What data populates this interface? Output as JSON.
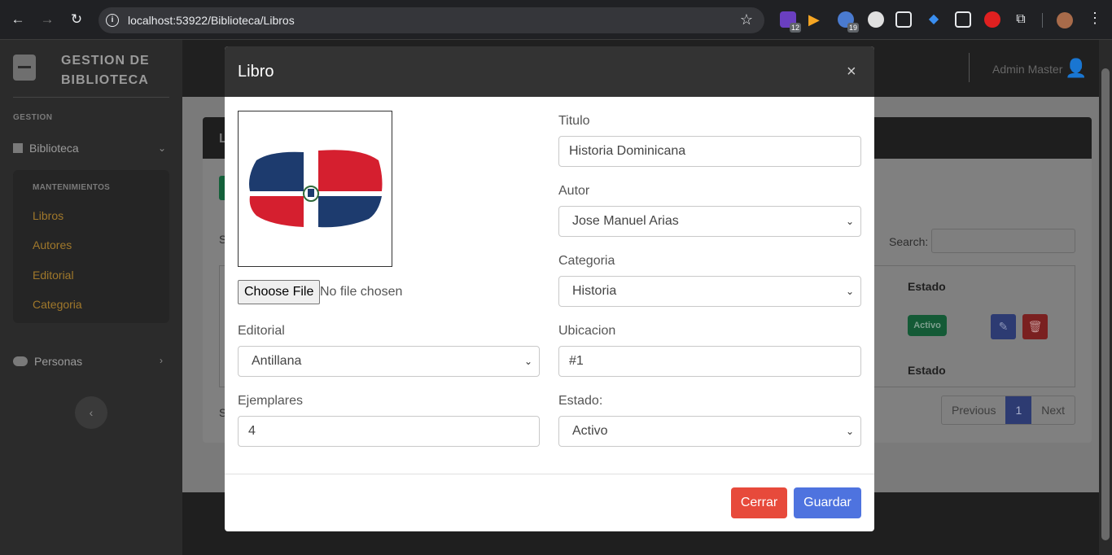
{
  "browser": {
    "url": "localhost:53922/Biblioteca/Libros",
    "badges": {
      "ext1": "12",
      "ext3": "19"
    }
  },
  "sidebar": {
    "brand_line1": "GESTION DE",
    "brand_line2": "BIBLIOTECA",
    "heading": "GESTION",
    "biblioteca": "Biblioteca",
    "sub_heading": "MANTENIMIENTOS",
    "links": [
      "Libros",
      "Autores",
      "Editorial",
      "Categoria"
    ],
    "personas": "Personas"
  },
  "topbar": {
    "user": "Admin Master"
  },
  "page": {
    "card_title_initial": "L",
    "search_label": "Search:",
    "col_estado": "Estado",
    "row_status": "Activo",
    "footer_estado": "Estado",
    "pager": {
      "previous": "Previous",
      "current": "1",
      "next": "Next"
    },
    "left_s1": "S",
    "left_s2": "S"
  },
  "modal": {
    "title": "Libro",
    "close": "×",
    "file_button": "Choose File",
    "file_status": "No file chosen",
    "titulo": {
      "label": "Titulo",
      "value": "Historia Dominicana"
    },
    "autor": {
      "label": "Autor",
      "value": "Jose Manuel Arias"
    },
    "categoria": {
      "label": "Categoria",
      "value": "Historia"
    },
    "editorial": {
      "label": "Editorial",
      "value": "Antillana"
    },
    "ubicacion": {
      "label": "Ubicacion",
      "value": "#1"
    },
    "ejemplares": {
      "label": "Ejemplares",
      "value": "4"
    },
    "estado": {
      "label": "Estado:",
      "value": "Activo"
    },
    "cerrar": "Cerrar",
    "guardar": "Guardar"
  },
  "colors": {
    "modal_header": "#333333",
    "btn_cerrar": "#e74a3b",
    "btn_guardar": "#4e73df",
    "sidebar_link": "#a0782b"
  }
}
